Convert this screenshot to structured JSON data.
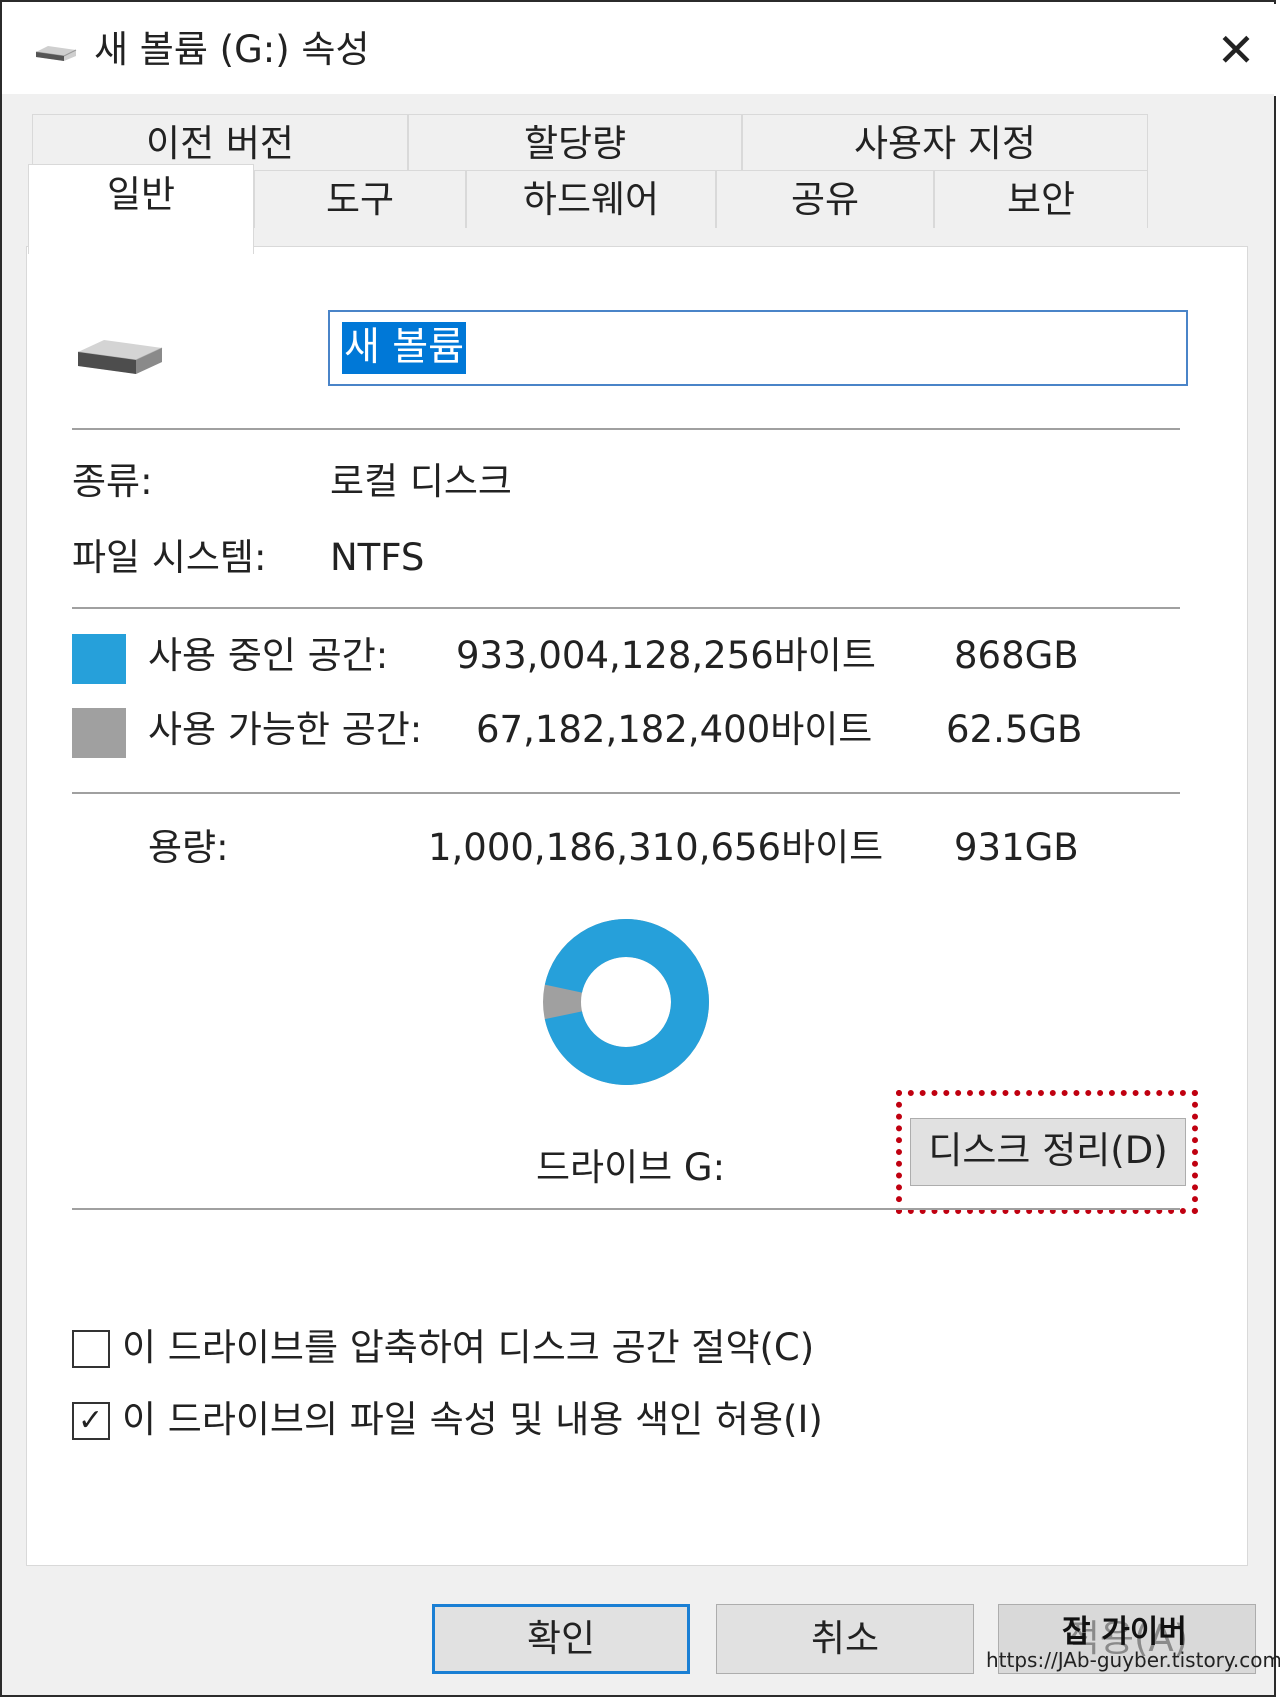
{
  "window": {
    "title": "새 볼륨 (G:) 속성",
    "close_glyph": "✕"
  },
  "tabs": {
    "row1": [
      {
        "label": "이전 버전"
      },
      {
        "label": "할당량"
      },
      {
        "label": "사용자 지정"
      }
    ],
    "row2": [
      {
        "label": "일반",
        "active": true
      },
      {
        "label": "도구"
      },
      {
        "label": "하드웨어"
      },
      {
        "label": "공유"
      },
      {
        "label": "보안"
      }
    ]
  },
  "general": {
    "volume_name": "새 볼륨",
    "type_label": "종류:",
    "type_value": "로컬 디스크",
    "fs_label": "파일 시스템:",
    "fs_value": "NTFS",
    "used_label": "사용 중인 공간:",
    "used_bytes": "933,004,128,256바이트",
    "used_size": "868GB",
    "free_label": "사용 가능한 공간:",
    "free_bytes": "67,182,182,400바이트",
    "free_size": "62.5GB",
    "capacity_label": "용량:",
    "capacity_bytes": "1,000,186,310,656바이트",
    "capacity_size": "931GB",
    "drive_label": "드라이브 G:",
    "cleanup_button": "디스크 정리(D)",
    "compress_checkbox": {
      "label": "이 드라이브를 압축하여 디스크 공간 절약(C)",
      "checked": false
    },
    "index_checkbox": {
      "label": "이 드라이브의 파일 속성 및 내용 색인 허용(I)",
      "checked": true
    }
  },
  "usage": {
    "used_fraction": 0.9328,
    "used_color": "#26a0da",
    "free_color": "#a0a0a0"
  },
  "buttons": {
    "ok": "확인",
    "cancel": "취소",
    "apply": "적용(A)"
  },
  "watermark": {
    "name": "잡 가이버",
    "url": "https://JAb-guyber.tistory.com"
  }
}
